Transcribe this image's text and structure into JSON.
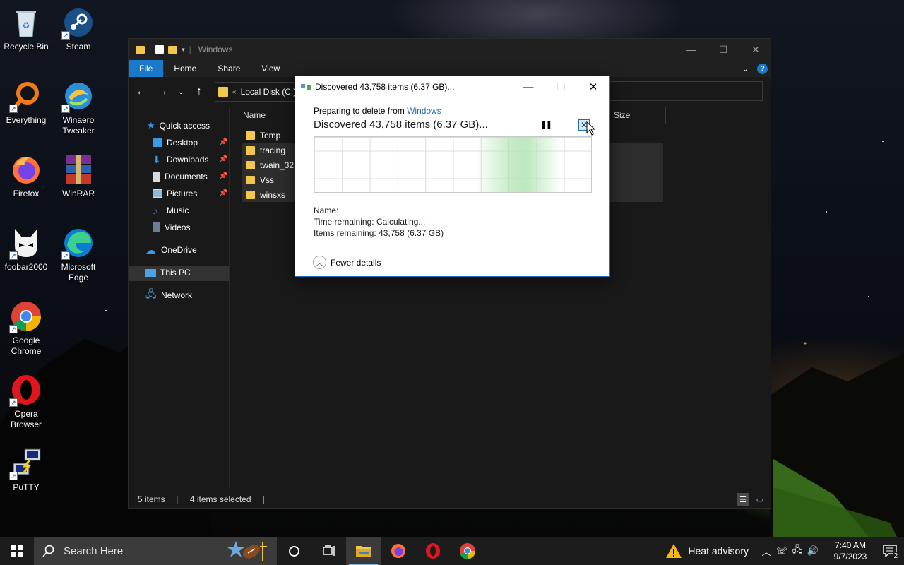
{
  "desktop": {
    "icons": [
      {
        "label": "Recycle Bin"
      },
      {
        "label": "Steam"
      },
      {
        "label": "Everything"
      },
      {
        "label": "Winaero Tweaker"
      },
      {
        "label": "Firefox"
      },
      {
        "label": "WinRAR"
      },
      {
        "label": "foobar2000"
      },
      {
        "label": "Microsoft Edge"
      },
      {
        "label": "Google Chrome"
      },
      {
        "label": "Opera Browser"
      },
      {
        "label": "PuTTY"
      }
    ]
  },
  "explorer": {
    "title": "Windows",
    "ribbon_tabs": [
      "File",
      "Home",
      "Share",
      "View"
    ],
    "breadcrumb": "Local Disk (C:)",
    "nav": {
      "quick_access": "Quick access",
      "desktop": "Desktop",
      "downloads": "Downloads",
      "documents": "Documents",
      "pictures": "Pictures",
      "music": "Music",
      "videos": "Videos",
      "onedrive": "OneDrive",
      "this_pc": "This PC",
      "network": "Network"
    },
    "columns": {
      "name": "Name",
      "size": "Size"
    },
    "files": [
      "Temp",
      "tracing",
      "twain_32",
      "Vss",
      "winsxs"
    ],
    "status": {
      "items": "5 items",
      "selected": "4 items selected"
    }
  },
  "dialog": {
    "title": "Discovered 43,758 items (6.37 GB)...",
    "prep_prefix": "Preparing to delete from",
    "prep_link": "Windows",
    "headline": "Discovered 43,758 items (6.37 GB)...",
    "name_label": "Name:",
    "time_label": "Time remaining:",
    "time_value": "Calculating...",
    "items_label": "Items remaining:",
    "items_value": "43,758 (6.37 GB)",
    "fewer_details": "Fewer details"
  },
  "taskbar": {
    "search_placeholder": "Search Here",
    "weather_text": "Heat advisory",
    "time": "7:40 AM",
    "date": "9/7/2023",
    "notification_count": "2"
  }
}
